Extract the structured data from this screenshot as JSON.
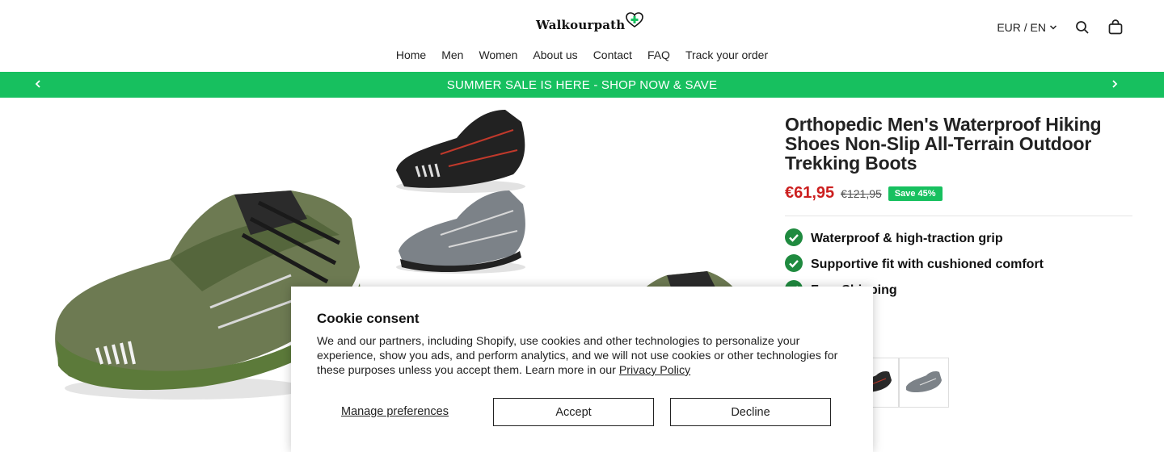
{
  "header": {
    "logo_text": "Walkourpath",
    "nav": [
      "Home",
      "Men",
      "Women",
      "About us",
      "Contact",
      "FAQ",
      "Track your order"
    ],
    "currency_label": "EUR / EN",
    "icons": {
      "search": "search-icon",
      "cart": "bag-icon",
      "dropdown": "chevron-down-icon"
    }
  },
  "announcement": {
    "text": "SUMMER SALE IS HERE - SHOP NOW & SAVE",
    "background": "#17c05f"
  },
  "product": {
    "title": "Orthopedic Men's Waterproof Hiking Shoes Non-Slip All-Terrain Outdoor Trekking Boots",
    "price": "€61,95",
    "compare_price": "€121,95",
    "save_badge": "Save 45%",
    "features": [
      "Waterproof & high-traction grip",
      "Supportive fit with cushioned comfort",
      "Free Shipping"
    ],
    "colors": {
      "price": "#cc1f1f",
      "badge": "#17c05f",
      "check": "#1f8a3f"
    }
  },
  "cookie": {
    "title": "Cookie consent",
    "body": "We and our partners, including Shopify, use cookies and other technologies to personalize your experience, show you ads, and perform analytics, and we will not use cookies or other technologies for these purposes unless you accept them. Learn more in our ",
    "policy_link": "Privacy Policy",
    "manage_label": "Manage preferences",
    "accept_label": "Accept",
    "decline_label": "Decline"
  }
}
